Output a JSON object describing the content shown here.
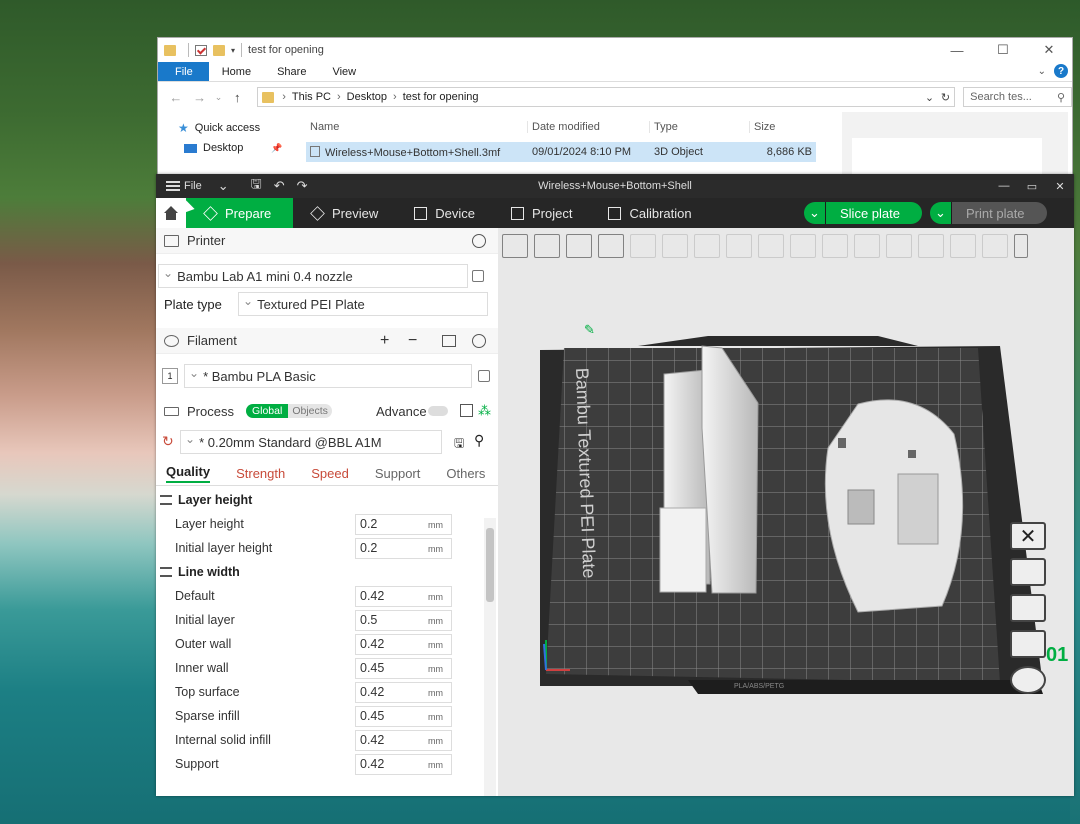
{
  "explorer": {
    "title": "test for opening",
    "ribbon": {
      "file": "File",
      "home": "Home",
      "share": "Share",
      "view": "View"
    },
    "breadcrumb": [
      "This PC",
      "Desktop",
      "test for opening"
    ],
    "search_placeholder": "Search tes...",
    "nav": {
      "quick_access": "Quick access",
      "desktop": "Desktop"
    },
    "columns": {
      "name": "Name",
      "date": "Date modified",
      "type": "Type",
      "size": "Size"
    },
    "files": [
      {
        "name": "Wireless+Mouse+Bottom+Shell.3mf",
        "date": "09/01/2024 8:10 PM",
        "type": "3D Object",
        "size": "8,686 KB"
      }
    ]
  },
  "bambu": {
    "title": "Wireless+Mouse+Bottom+Shell",
    "menu_file": "File",
    "tabs": [
      "Prepare",
      "Preview",
      "Device",
      "Project",
      "Calibration"
    ],
    "slice_label": "Slice plate",
    "print_label": "Print plate",
    "printer": {
      "section": "Printer",
      "selected": "Bambu Lab A1 mini 0.4 nozzle",
      "plate_type_label": "Plate type",
      "plate_type": "Textured PEI Plate"
    },
    "filament": {
      "section": "Filament",
      "slot": "1",
      "selected": "* Bambu PLA Basic"
    },
    "process": {
      "section": "Process",
      "global": "Global",
      "objects": "Objects",
      "advance": "Advance",
      "preset": "* 0.20mm Standard @BBL A1M",
      "tabs": [
        "Quality",
        "Strength",
        "Speed",
        "Support",
        "Others"
      ],
      "groups": [
        {
          "title": "Layer height",
          "rows": [
            {
              "label": "Layer height",
              "value": "0.2",
              "unit": "mm"
            },
            {
              "label": "Initial layer height",
              "value": "0.2",
              "unit": "mm"
            }
          ]
        },
        {
          "title": "Line width",
          "rows": [
            {
              "label": "Default",
              "value": "0.42",
              "unit": "mm"
            },
            {
              "label": "Initial layer",
              "value": "0.5",
              "unit": "mm"
            },
            {
              "label": "Outer wall",
              "value": "0.42",
              "unit": "mm"
            },
            {
              "label": "Inner wall",
              "value": "0.45",
              "unit": "mm"
            },
            {
              "label": "Top surface",
              "value": "0.42",
              "unit": "mm"
            },
            {
              "label": "Sparse infill",
              "value": "0.45",
              "unit": "mm"
            },
            {
              "label": "Internal solid infill",
              "value": "0.42",
              "unit": "mm"
            },
            {
              "label": "Support",
              "value": "0.42",
              "unit": "mm"
            }
          ]
        }
      ]
    },
    "bed_text": "Bambu Textured PEI Plate",
    "bed_label_strip": "PLA/ABS/PETG",
    "plate_number": "01",
    "accent": "#00ae42"
  }
}
